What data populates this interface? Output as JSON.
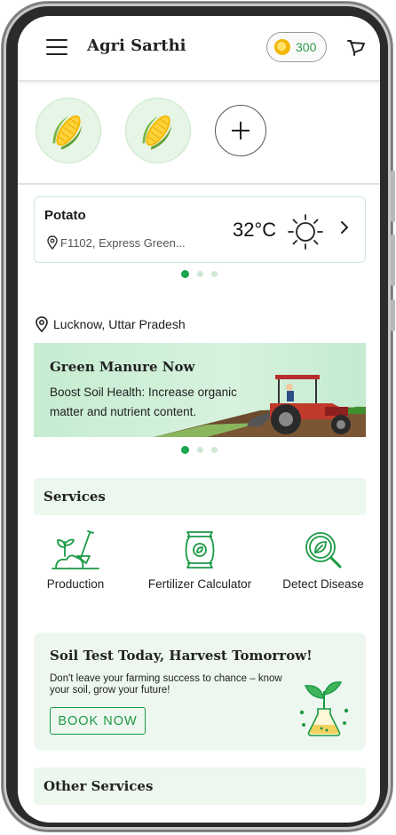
{
  "header": {
    "title": "Agri Sarthi",
    "coins": "300",
    "menu_icon": "menu-icon",
    "coin_icon": "coin-icon",
    "cart_icon": "cart-icon"
  },
  "crops": {
    "items": [
      {
        "name": "Corn",
        "icon": "corn-icon"
      },
      {
        "name": "Corn",
        "icon": "corn-icon"
      }
    ],
    "add_icon": "plus-icon"
  },
  "weather": {
    "crop": "Potato",
    "location": "F1102, Express Green...",
    "temperature": "32°C",
    "condition_icon": "sun-icon"
  },
  "location": {
    "text": "Lucknow, Uttar Pradesh"
  },
  "banner": {
    "title": "Green Manure Now",
    "text": "Boost Soil Health: Increase organic matter and nutrient content."
  },
  "services": {
    "title": "Services",
    "items": [
      {
        "label": "Production",
        "icon": "production-icon"
      },
      {
        "label": "Fertilizer Calculator",
        "icon": "fertilizer-bag-icon"
      },
      {
        "label": "Detect Disease",
        "icon": "disease-search-icon"
      }
    ]
  },
  "promo": {
    "title": "Soil Test Today, Harvest Tomorrow!",
    "text": "Don't leave your farming success to chance – know your soil, grow your future!",
    "button": "BOOK NOW"
  },
  "other_services": {
    "title": "Other Services"
  },
  "colors": {
    "primary_green": "#1a9a44",
    "light_green_bg": "#ecf7ee",
    "coin_gold": "#f2b705"
  }
}
